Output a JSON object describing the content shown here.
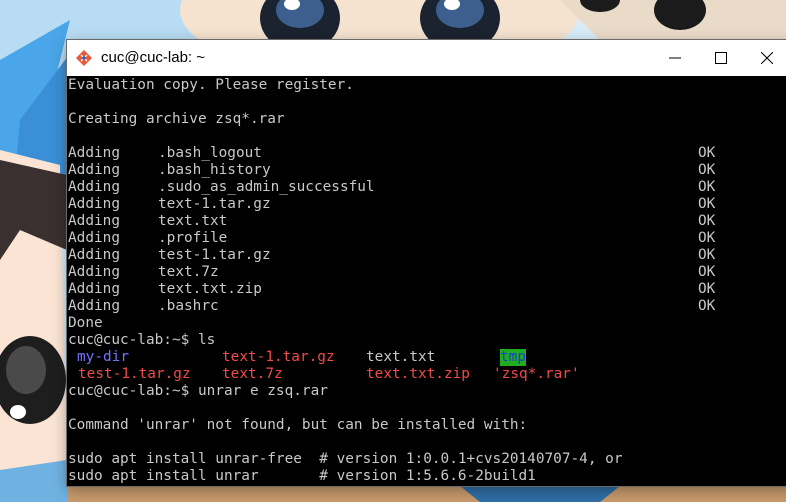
{
  "window": {
    "title": "cuc@cuc-lab: ~"
  },
  "terminal": {
    "eval_line": "Evaluation copy. Please register.",
    "creating_line": "Creating archive zsq*.rar",
    "adding": [
      {
        "verb": "Adding",
        "file": ".bash_logout",
        "status": "OK"
      },
      {
        "verb": "Adding",
        "file": ".bash_history",
        "status": "OK"
      },
      {
        "verb": "Adding",
        "file": ".sudo_as_admin_successful",
        "status": "OK"
      },
      {
        "verb": "Adding",
        "file": "text-1.tar.gz",
        "status": "OK"
      },
      {
        "verb": "Adding",
        "file": "text.txt",
        "status": "OK"
      },
      {
        "verb": "Adding",
        "file": ".profile",
        "status": "OK"
      },
      {
        "verb": "Adding",
        "file": "test-1.tar.gz",
        "status": "OK"
      },
      {
        "verb": "Adding",
        "file": "text.7z",
        "status": "OK"
      },
      {
        "verb": "Adding",
        "file": "text.txt.zip",
        "status": "OK"
      },
      {
        "verb": "Adding",
        "file": ".bashrc",
        "status": "OK"
      }
    ],
    "done_line": "Done",
    "prompt1": "cuc@cuc-lab:~$ ls",
    "ls_row1": [
      "my-dir",
      "text-1.tar.gz",
      "text.txt",
      "tmp"
    ],
    "ls_row2": [
      "test-1.tar.gz",
      "text.7z",
      "text.txt.zip",
      "'zsq*.rar'"
    ],
    "prompt2": "cuc@cuc-lab:~$ unrar e zsq.rar",
    "notfound_line": "Command 'unrar' not found, but can be installed with:",
    "install1": "sudo apt install unrar-free  # version 1:0.0.1+cvs20140707-4, or",
    "install2": "sudo apt install unrar       # version 1:5.6.6-2build1"
  },
  "colors": {
    "directory": "#7272ff",
    "archive": "#f04a4a",
    "tmp_bg": "#1fae1f",
    "tmp_fg": "#1f3ad8",
    "text": "#c8c8c8"
  }
}
